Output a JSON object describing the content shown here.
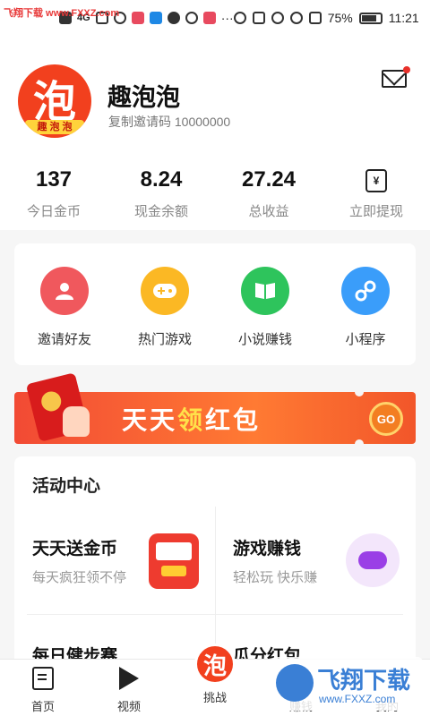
{
  "watermark_top": "飞翔下载 www.FXXZ.com",
  "status_bar": {
    "battery": "75%",
    "time": "11:21",
    "network": "4G"
  },
  "profile": {
    "name": "趣泡泡",
    "invite_label": "复制邀请码",
    "invite_code": "10000000",
    "avatar_glyph": "泡",
    "avatar_strip": "趣 泡 泡"
  },
  "stats": [
    {
      "value": "137",
      "label": "今日金币"
    },
    {
      "value": "8.24",
      "label": "现金余额"
    },
    {
      "value": "27.24",
      "label": "总收益"
    },
    {
      "value": "",
      "label": "立即提现",
      "icon": "wallet-icon"
    }
  ],
  "wallet_glyph": "¥",
  "shortcuts": [
    {
      "label": "邀请好友",
      "icon": "user-icon",
      "color": "#f0585d"
    },
    {
      "label": "热门游戏",
      "icon": "gamepad-icon",
      "color": "#fbb824"
    },
    {
      "label": "小说赚钱",
      "icon": "book-icon",
      "color": "#2ec45c"
    },
    {
      "label": "小程序",
      "icon": "link-icon",
      "color": "#3a9dfa"
    }
  ],
  "banner": {
    "text_part1": "天天",
    "text_highlight": "领",
    "text_part2": "红包",
    "go_label": "GO"
  },
  "activity": {
    "title": "活动中心",
    "items": [
      {
        "title": "天天送金币",
        "subtitle": "每天疯狂领不停"
      },
      {
        "title": "游戏赚钱",
        "subtitle": "轻松玩 快乐赚"
      },
      {
        "title": "每日健步赛",
        "subtitle": ""
      },
      {
        "title": "瓜分红包",
        "subtitle": ""
      }
    ]
  },
  "tabbar": {
    "items": [
      {
        "label": "首页"
      },
      {
        "label": "视频"
      },
      {
        "label": "挑战"
      },
      {
        "label": "赚钱"
      },
      {
        "label": "我的"
      }
    ],
    "challenge_glyph": "泡"
  },
  "watermark_bottom": {
    "big": "飞翔下载",
    "small": "www.FXXZ.com"
  }
}
